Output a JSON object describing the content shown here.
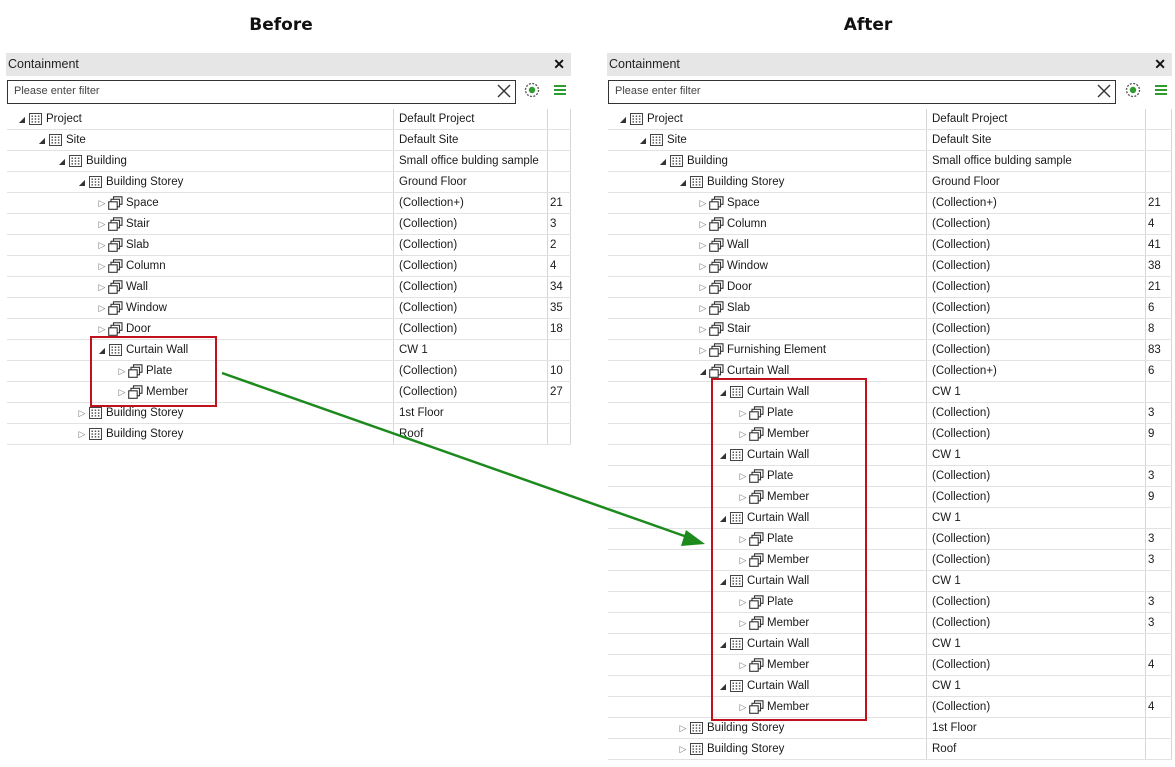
{
  "headings": {
    "before": "Before",
    "after": "After"
  },
  "panel": {
    "title": "Containment",
    "close_glyph": "✕",
    "filter_placeholder": "Please enter filter",
    "icons": {
      "clear": "clear-x-icon",
      "settings": "gear-icon",
      "menu": "hamburger-menu-icon"
    },
    "accent_color": "#2e9b2e"
  },
  "before": {
    "rows": [
      {
        "level": 0,
        "open": true,
        "icon": "grid",
        "label": "Project",
        "value": "Default Project",
        "count": ""
      },
      {
        "level": 1,
        "open": true,
        "icon": "grid",
        "label": "Site",
        "value": "Default Site",
        "count": ""
      },
      {
        "level": 2,
        "open": true,
        "icon": "grid",
        "label": "Building",
        "value": "Small office bulding sample",
        "count": ""
      },
      {
        "level": 3,
        "open": true,
        "icon": "grid",
        "label": "Building Storey",
        "value": "Ground Floor",
        "count": ""
      },
      {
        "level": 4,
        "open": false,
        "icon": "collection",
        "label": "Space",
        "value": "(Collection+)",
        "count": "21"
      },
      {
        "level": 4,
        "open": false,
        "icon": "collection",
        "label": "Stair",
        "value": "(Collection)",
        "count": "3"
      },
      {
        "level": 4,
        "open": false,
        "icon": "collection",
        "label": "Slab",
        "value": "(Collection)",
        "count": "2"
      },
      {
        "level": 4,
        "open": false,
        "icon": "collection",
        "label": "Column",
        "value": "(Collection)",
        "count": "4"
      },
      {
        "level": 4,
        "open": false,
        "icon": "collection",
        "label": "Wall",
        "value": "(Collection)",
        "count": "34"
      },
      {
        "level": 4,
        "open": false,
        "icon": "collection",
        "label": "Window",
        "value": "(Collection)",
        "count": "35"
      },
      {
        "level": 4,
        "open": false,
        "icon": "collection",
        "label": "Door",
        "value": "(Collection)",
        "count": "18"
      },
      {
        "level": 4,
        "open": true,
        "icon": "grid",
        "label": "Curtain Wall",
        "value": "CW 1",
        "count": ""
      },
      {
        "level": 5,
        "open": false,
        "icon": "collection",
        "label": "Plate",
        "value": "(Collection)",
        "count": "10"
      },
      {
        "level": 5,
        "open": false,
        "icon": "collection",
        "label": "Member",
        "value": "(Collection)",
        "count": "27"
      },
      {
        "level": 3,
        "open": false,
        "icon": "grid",
        "label": "Building Storey",
        "value": "1st Floor",
        "count": ""
      },
      {
        "level": 3,
        "open": false,
        "icon": "grid",
        "label": "Building Storey",
        "value": "Roof",
        "count": ""
      }
    ]
  },
  "after": {
    "rows": [
      {
        "level": 0,
        "open": true,
        "icon": "grid",
        "label": "Project",
        "value": "Default Project",
        "count": ""
      },
      {
        "level": 1,
        "open": true,
        "icon": "grid",
        "label": "Site",
        "value": "Default Site",
        "count": ""
      },
      {
        "level": 2,
        "open": true,
        "icon": "grid",
        "label": "Building",
        "value": "Small office bulding sample",
        "count": ""
      },
      {
        "level": 3,
        "open": true,
        "icon": "grid",
        "label": "Building Storey",
        "value": "Ground Floor",
        "count": ""
      },
      {
        "level": 4,
        "open": false,
        "icon": "collection",
        "label": "Space",
        "value": "(Collection+)",
        "count": "21"
      },
      {
        "level": 4,
        "open": false,
        "icon": "collection",
        "label": "Column",
        "value": "(Collection)",
        "count": "4"
      },
      {
        "level": 4,
        "open": false,
        "icon": "collection",
        "label": "Wall",
        "value": "(Collection)",
        "count": "41"
      },
      {
        "level": 4,
        "open": false,
        "icon": "collection",
        "label": "Window",
        "value": "(Collection)",
        "count": "38"
      },
      {
        "level": 4,
        "open": false,
        "icon": "collection",
        "label": "Door",
        "value": "(Collection)",
        "count": "21"
      },
      {
        "level": 4,
        "open": false,
        "icon": "collection",
        "label": "Slab",
        "value": "(Collection)",
        "count": "6"
      },
      {
        "level": 4,
        "open": false,
        "icon": "collection",
        "label": "Stair",
        "value": "(Collection)",
        "count": "8"
      },
      {
        "level": 4,
        "open": false,
        "icon": "collection",
        "label": "Furnishing Element",
        "value": "(Collection)",
        "count": "83"
      },
      {
        "level": 4,
        "open": true,
        "icon": "collection",
        "label": "Curtain Wall",
        "value": "(Collection+)",
        "count": "6"
      },
      {
        "level": 5,
        "open": true,
        "icon": "grid",
        "label": "Curtain Wall",
        "value": "CW 1",
        "count": ""
      },
      {
        "level": 6,
        "open": false,
        "icon": "collection",
        "label": "Plate",
        "value": "(Collection)",
        "count": "3"
      },
      {
        "level": 6,
        "open": false,
        "icon": "collection",
        "label": "Member",
        "value": "(Collection)",
        "count": "9"
      },
      {
        "level": 5,
        "open": true,
        "icon": "grid",
        "label": "Curtain Wall",
        "value": "CW 1",
        "count": ""
      },
      {
        "level": 6,
        "open": false,
        "icon": "collection",
        "label": "Plate",
        "value": "(Collection)",
        "count": "3"
      },
      {
        "level": 6,
        "open": false,
        "icon": "collection",
        "label": "Member",
        "value": "(Collection)",
        "count": "9"
      },
      {
        "level": 5,
        "open": true,
        "icon": "grid",
        "label": "Curtain Wall",
        "value": "CW 1",
        "count": ""
      },
      {
        "level": 6,
        "open": false,
        "icon": "collection",
        "label": "Plate",
        "value": "(Collection)",
        "count": "3"
      },
      {
        "level": 6,
        "open": false,
        "icon": "collection",
        "label": "Member",
        "value": "(Collection)",
        "count": "3"
      },
      {
        "level": 5,
        "open": true,
        "icon": "grid",
        "label": "Curtain Wall",
        "value": "CW 1",
        "count": ""
      },
      {
        "level": 6,
        "open": false,
        "icon": "collection",
        "label": "Plate",
        "value": "(Collection)",
        "count": "3"
      },
      {
        "level": 6,
        "open": false,
        "icon": "collection",
        "label": "Member",
        "value": "(Collection)",
        "count": "3"
      },
      {
        "level": 5,
        "open": true,
        "icon": "grid",
        "label": "Curtain Wall",
        "value": "CW 1",
        "count": ""
      },
      {
        "level": 6,
        "open": false,
        "icon": "collection",
        "label": "Member",
        "value": "(Collection)",
        "count": "4"
      },
      {
        "level": 5,
        "open": true,
        "icon": "grid",
        "label": "Curtain Wall",
        "value": "CW 1",
        "count": ""
      },
      {
        "level": 6,
        "open": false,
        "icon": "collection",
        "label": "Member",
        "value": "(Collection)",
        "count": "4"
      },
      {
        "level": 3,
        "open": false,
        "icon": "grid",
        "label": "Building Storey",
        "value": "1st Floor",
        "count": ""
      },
      {
        "level": 3,
        "open": false,
        "icon": "grid",
        "label": "Building Storey",
        "value": "Roof",
        "count": ""
      }
    ]
  },
  "annotation": {
    "highlight_color": "#c0121c",
    "arrow_color": "#1d8a1d"
  }
}
